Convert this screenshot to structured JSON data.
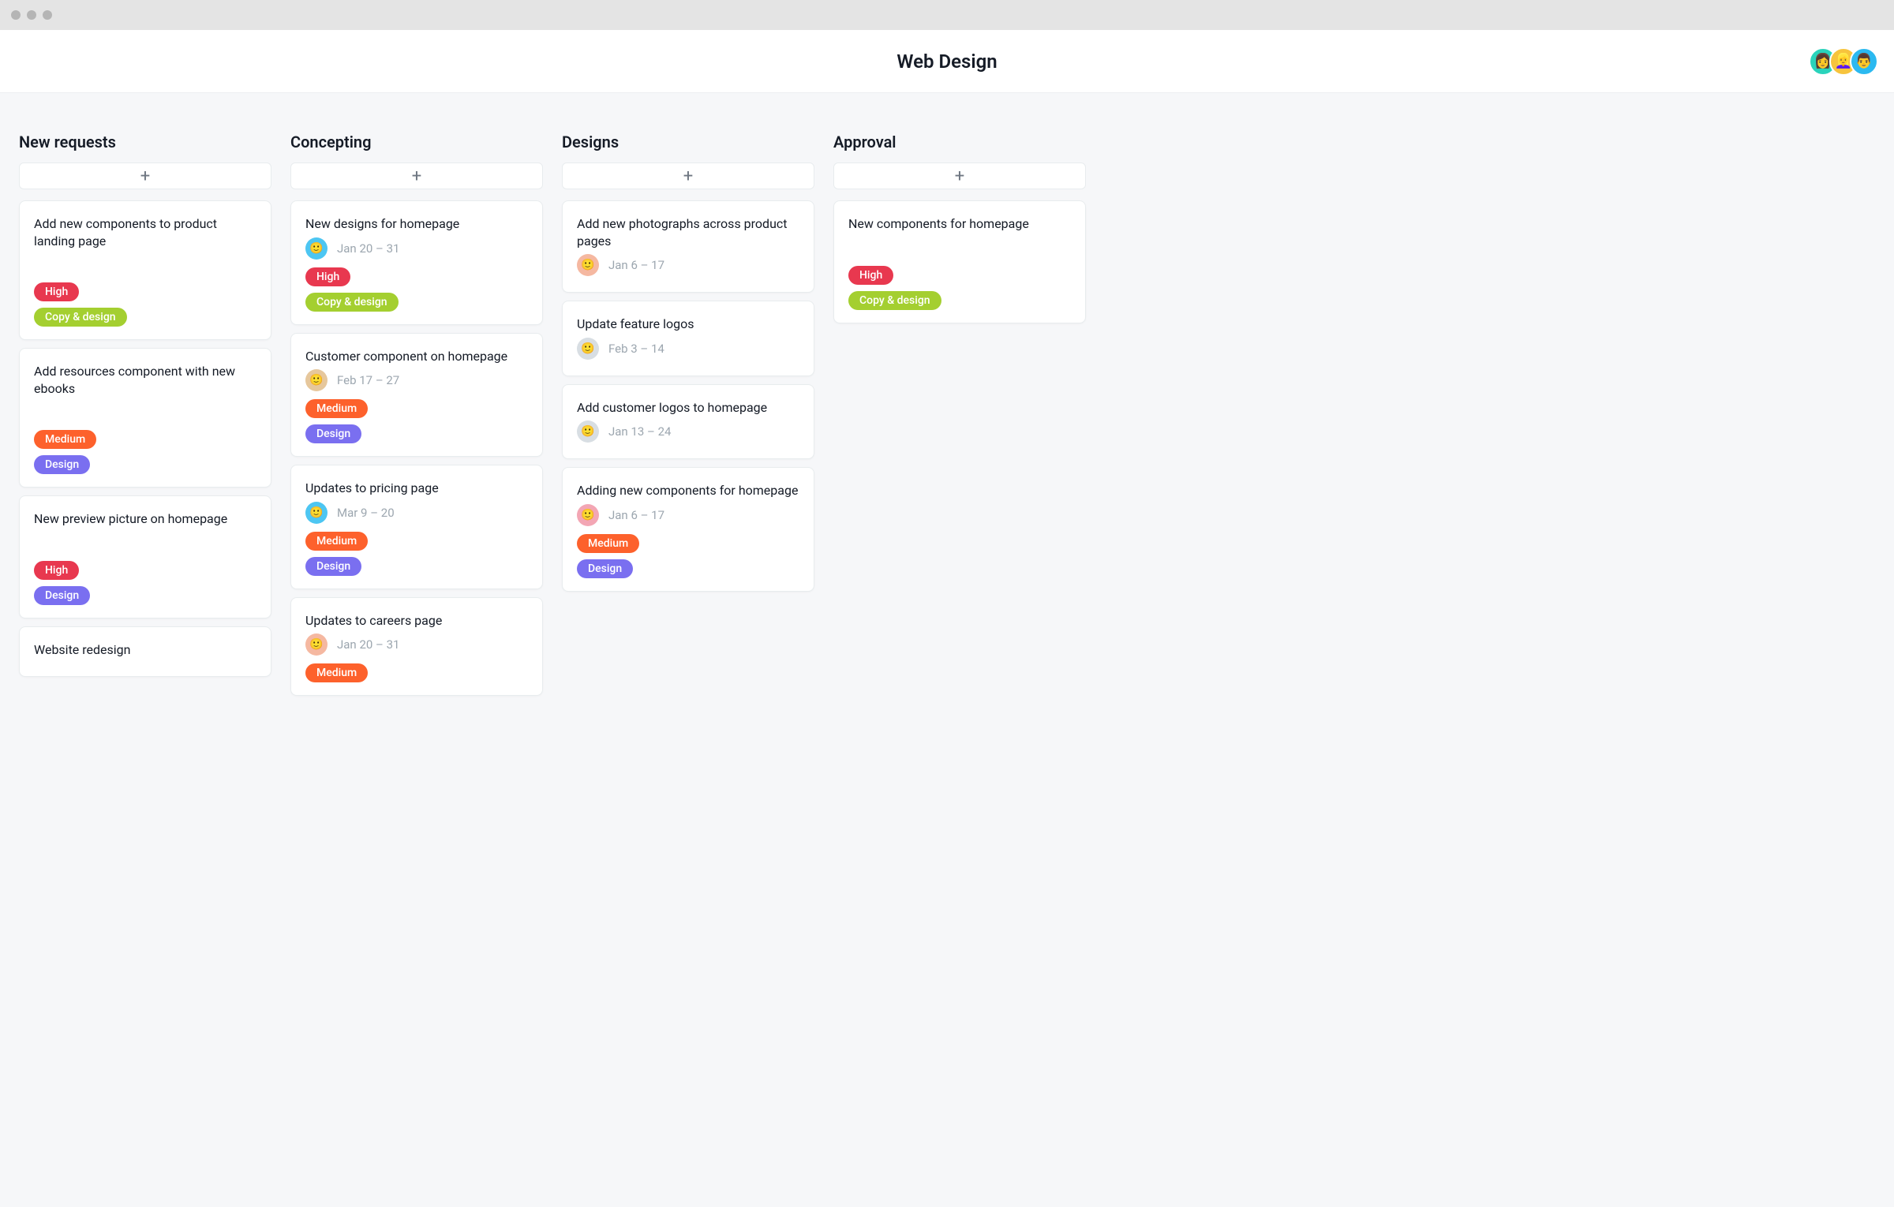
{
  "header": {
    "title": "Web Design",
    "avatars": [
      {
        "bg": "#2ad3bb",
        "emoji": "👩"
      },
      {
        "bg": "#f7c43d",
        "emoji": "👱‍♀️"
      },
      {
        "bg": "#2bb9f0",
        "emoji": "👨"
      }
    ]
  },
  "tagColors": {
    "High": "#e8384f",
    "Medium": "#fd612c",
    "Copy & design": "#a4cf30",
    "Design": "#7a6ff0"
  },
  "assigneeColors": {
    "blue": "#4dc6f2",
    "tan": "#e6c79c",
    "peach": "#f5b8a1",
    "pink": "#f3a6b4",
    "gray": "#d8dee3"
  },
  "columns": [
    {
      "title": "New requests",
      "cards": [
        {
          "title": "Add new components to product landing page",
          "gap": true,
          "tags": [
            "High",
            "Copy & design"
          ]
        },
        {
          "title": "Add resources component with new ebooks",
          "gap": true,
          "tags": [
            "Medium",
            "Design"
          ]
        },
        {
          "title": "New preview picture on homepage",
          "gap": true,
          "tags": [
            "High",
            "Design"
          ]
        },
        {
          "title": "Website redesign"
        }
      ]
    },
    {
      "title": "Concepting",
      "cards": [
        {
          "title": "New designs for homepage",
          "assignee": "blue",
          "date": "Jan 20 – 31",
          "tags": [
            "High",
            "Copy & design"
          ]
        },
        {
          "title": "Customer component on homepage",
          "assignee": "tan",
          "date": "Feb 17 – 27",
          "tags": [
            "Medium",
            "Design"
          ]
        },
        {
          "title": "Updates to pricing page",
          "assignee": "blue",
          "date": "Mar 9 – 20",
          "tags": [
            "Medium",
            "Design"
          ]
        },
        {
          "title": "Updates to careers page",
          "assignee": "peach",
          "date": "Jan 20 – 31",
          "tags": [
            "Medium"
          ]
        }
      ]
    },
    {
      "title": "Designs",
      "cards": [
        {
          "title": "Add new photographs across product pages",
          "assignee": "peach",
          "date": "Jan 6 – 17"
        },
        {
          "title": "Update feature logos",
          "assignee": "gray",
          "date": "Feb 3 – 14"
        },
        {
          "title": "Add customer logos to homepage",
          "assignee": "gray",
          "date": "Jan 13 – 24"
        },
        {
          "title": "Adding new components for homepage",
          "assignee": "pink",
          "date": "Jan 6 – 17",
          "tags": [
            "Medium",
            "Design"
          ]
        }
      ]
    },
    {
      "title": "Approval",
      "cards": [
        {
          "title": "New components for homepage",
          "gap": true,
          "tags": [
            "High",
            "Copy & design"
          ]
        }
      ]
    }
  ]
}
